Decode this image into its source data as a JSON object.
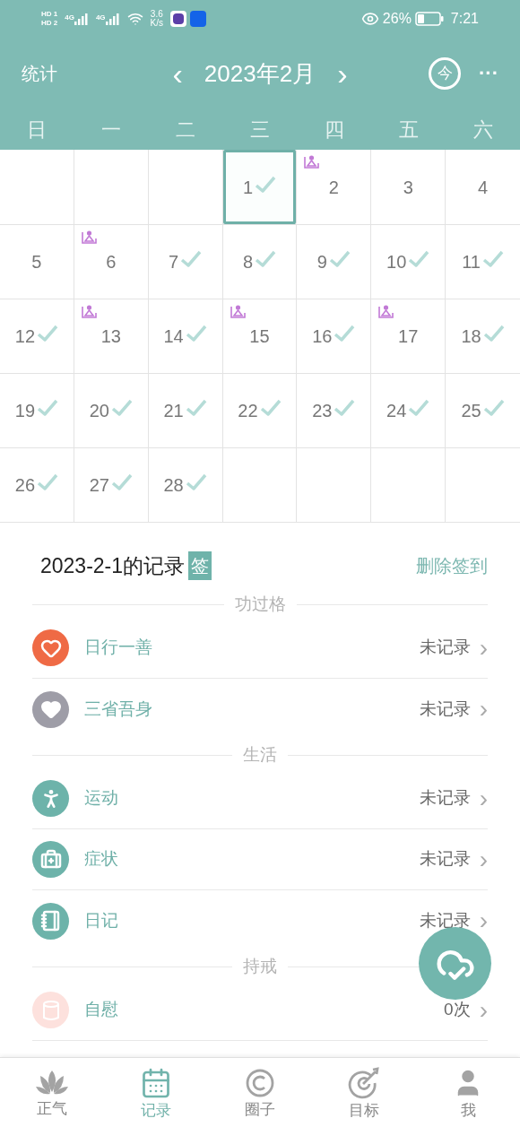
{
  "status_bar": {
    "sim_labels": [
      "HD 1",
      "HD 2"
    ],
    "networks": [
      "4G",
      "4G"
    ],
    "speed": [
      "3.6",
      "K/s"
    ],
    "battery": "26%",
    "time": "7:21"
  },
  "header": {
    "left": "统计",
    "month": "2023年2月",
    "prev": "‹",
    "next": "›",
    "today": "今",
    "more": "···"
  },
  "weekdays": [
    "日",
    "一",
    "二",
    "三",
    "四",
    "五",
    "六"
  ],
  "calendar": [
    [
      {
        "kind": "blank"
      },
      {
        "kind": "blank"
      },
      {
        "kind": "blank"
      },
      {
        "kind": "day",
        "day": "1",
        "checked": true,
        "badge": false,
        "selected": true
      },
      {
        "day": "2",
        "checked": false,
        "badge": true,
        "selected": false
      },
      {
        "day": "3",
        "checked": false,
        "badge": false,
        "selected": false
      },
      {
        "day": "4",
        "checked": false,
        "badge": false,
        "selected": false
      }
    ],
    [
      {
        "day": "5",
        "checked": false,
        "badge": false,
        "selected": false
      },
      {
        "day": "6",
        "checked": false,
        "badge": true,
        "selected": false
      },
      {
        "day": "7",
        "checked": true,
        "badge": false,
        "selected": false
      },
      {
        "day": "8",
        "checked": true,
        "badge": false,
        "selected": false
      },
      {
        "day": "9",
        "checked": true,
        "badge": false,
        "selected": false
      },
      {
        "day": "10",
        "checked": true,
        "badge": false,
        "selected": false
      },
      {
        "day": "11",
        "checked": true,
        "badge": false,
        "selected": false
      }
    ],
    [
      {
        "day": "12",
        "checked": true,
        "badge": false,
        "selected": false
      },
      {
        "day": "13",
        "checked": false,
        "badge": true,
        "selected": false
      },
      {
        "day": "14",
        "checked": true,
        "badge": false,
        "selected": false
      },
      {
        "day": "15",
        "checked": false,
        "badge": true,
        "selected": false
      },
      {
        "day": "16",
        "checked": true,
        "badge": false,
        "selected": false
      },
      {
        "day": "17",
        "checked": false,
        "badge": true,
        "selected": false
      },
      {
        "day": "18",
        "checked": true,
        "badge": false,
        "selected": false
      }
    ],
    [
      {
        "day": "19",
        "checked": true,
        "badge": false,
        "selected": false
      },
      {
        "day": "20",
        "checked": true,
        "badge": false,
        "selected": false
      },
      {
        "day": "21",
        "checked": true,
        "badge": false,
        "selected": false
      },
      {
        "day": "22",
        "checked": true,
        "badge": false,
        "selected": false
      },
      {
        "day": "23",
        "checked": true,
        "badge": false,
        "selected": false
      },
      {
        "day": "24",
        "checked": true,
        "badge": false,
        "selected": false
      },
      {
        "day": "25",
        "checked": true,
        "badge": false,
        "selected": false
      }
    ],
    [
      {
        "day": "26",
        "checked": true,
        "badge": false,
        "selected": false
      },
      {
        "day": "27",
        "checked": true,
        "badge": false,
        "selected": false
      },
      {
        "day": "28",
        "checked": true,
        "badge": false,
        "selected": false
      },
      {
        "kind": "blank"
      },
      {
        "kind": "blank"
      },
      {
        "kind": "blank"
      },
      {
        "kind": "blank"
      }
    ]
  ],
  "record": {
    "title": "2023-2-1的记录",
    "tag": "签",
    "action": "删除签到",
    "sections": [
      {
        "title": "功过格",
        "items": [
          {
            "kind": "heart",
            "color": "#ef6a45",
            "label": "日行一善",
            "value": "未记录",
            "arrow": "›"
          },
          {
            "kind": "broken-heart",
            "color": "#9e9da7",
            "label": "三省吾身",
            "value": "未记录",
            "arrow": "›"
          }
        ]
      },
      {
        "title": "生活",
        "items": [
          {
            "kind": "run",
            "color": "#6db3aa",
            "label": "运动",
            "value": "未记录",
            "arrow": "›"
          },
          {
            "kind": "medical",
            "color": "#6db3aa",
            "label": "症状",
            "value": "未记录",
            "arrow": "›"
          },
          {
            "kind": "notebook",
            "color": "#6db3aa",
            "label": "日记",
            "value": "未记录",
            "arrow": "›"
          }
        ]
      },
      {
        "title": "持戒",
        "items": [
          {
            "kind": "paper",
            "color": "#fde1dd",
            "label": "自慰",
            "value": "0次",
            "arrow": "›"
          }
        ]
      }
    ]
  },
  "nav": [
    {
      "kind": "lotus",
      "label": "正气",
      "selected": false
    },
    {
      "kind": "calendar",
      "label": "记录",
      "selected": true
    },
    {
      "kind": "circle",
      "label": "圈子",
      "selected": false
    },
    {
      "kind": "target",
      "label": "目标",
      "selected": false
    },
    {
      "kind": "user",
      "label": "我",
      "selected": false
    }
  ]
}
